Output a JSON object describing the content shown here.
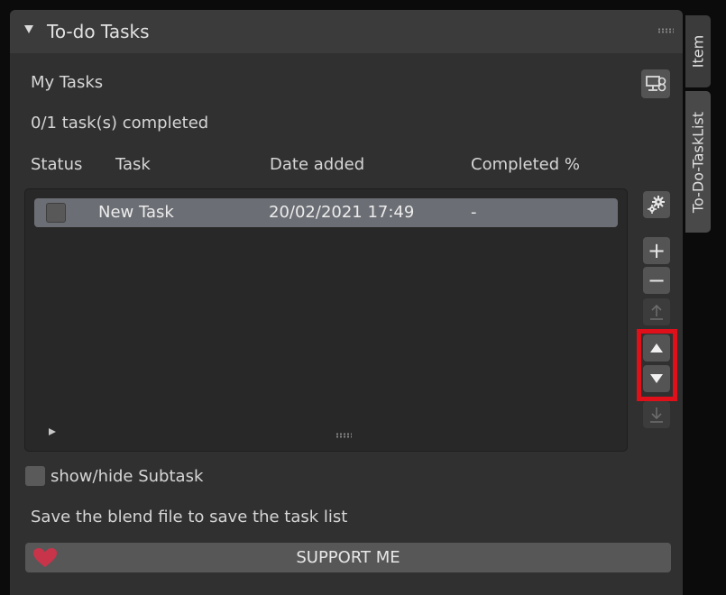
{
  "panel": {
    "title": "To-do Tasks",
    "list_name": "My Tasks",
    "progress_text": "0/1 task(s) completed"
  },
  "columns": [
    "Status",
    "Task",
    "Date added",
    "Completed %"
  ],
  "tasks": [
    {
      "name": "New Task",
      "date_added": "20/02/2021 17:49",
      "completed": "-",
      "done": false
    }
  ],
  "side_buttons": {
    "add": "+",
    "remove": "−"
  },
  "subtask_toggle_label": "show/hide Subtask",
  "save_hint": "Save the blend file to save the task list",
  "support_label": "SUPPORT ME",
  "tabs": [
    "Item",
    "To-Do-TaskList"
  ],
  "colors": {
    "highlight": "#e0101b",
    "heart": "#c8344a",
    "row_selected": "#6b6e74"
  },
  "icons": {
    "export": "monitor-link-icon",
    "settings": "gears-icon",
    "move_up": "triangle-up-icon",
    "move_down": "triangle-down-icon",
    "move_top": "arrow-to-top-icon",
    "move_bottom": "arrow-to-bottom-icon",
    "support": "heart-icon"
  }
}
